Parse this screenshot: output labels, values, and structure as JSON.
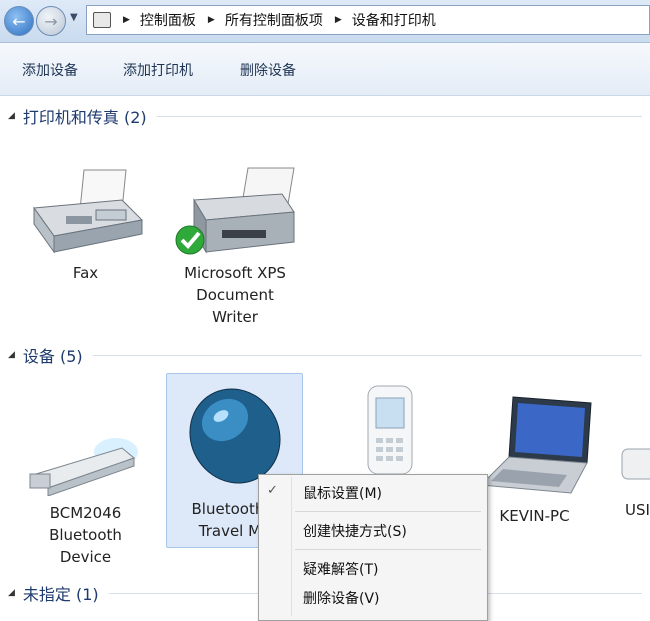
{
  "address_bar": {
    "crumbs": [
      "控制面板",
      "所有控制面板项",
      "设备和打印机"
    ]
  },
  "toolbar": {
    "add_device": "添加设备",
    "add_printer": "添加打印机",
    "remove_device": "删除设备"
  },
  "groups": {
    "printers": {
      "title": "打印机和传真 (2)"
    },
    "devices": {
      "title": "设备 (5)"
    },
    "unspecified": {
      "title": "未指定 (1)"
    }
  },
  "printers": [
    {
      "label": "Fax"
    },
    {
      "label": "Microsoft XPS\nDocument\nWriter"
    }
  ],
  "devices": [
    {
      "label": "BCM2046\nBluetooth\nDevice"
    },
    {
      "label": "Bluetooth L\nTravel Mo"
    },
    {
      "label": ""
    },
    {
      "label": "KEVIN-PC"
    },
    {
      "label": "USI"
    }
  ],
  "context_menu": {
    "items": [
      "鼠标设置(M)",
      "创建快捷方式(S)",
      "疑难解答(T)",
      "删除设备(V)"
    ]
  },
  "colors": {
    "accent": "#1e3a6e",
    "selection": "#dde9f8"
  }
}
